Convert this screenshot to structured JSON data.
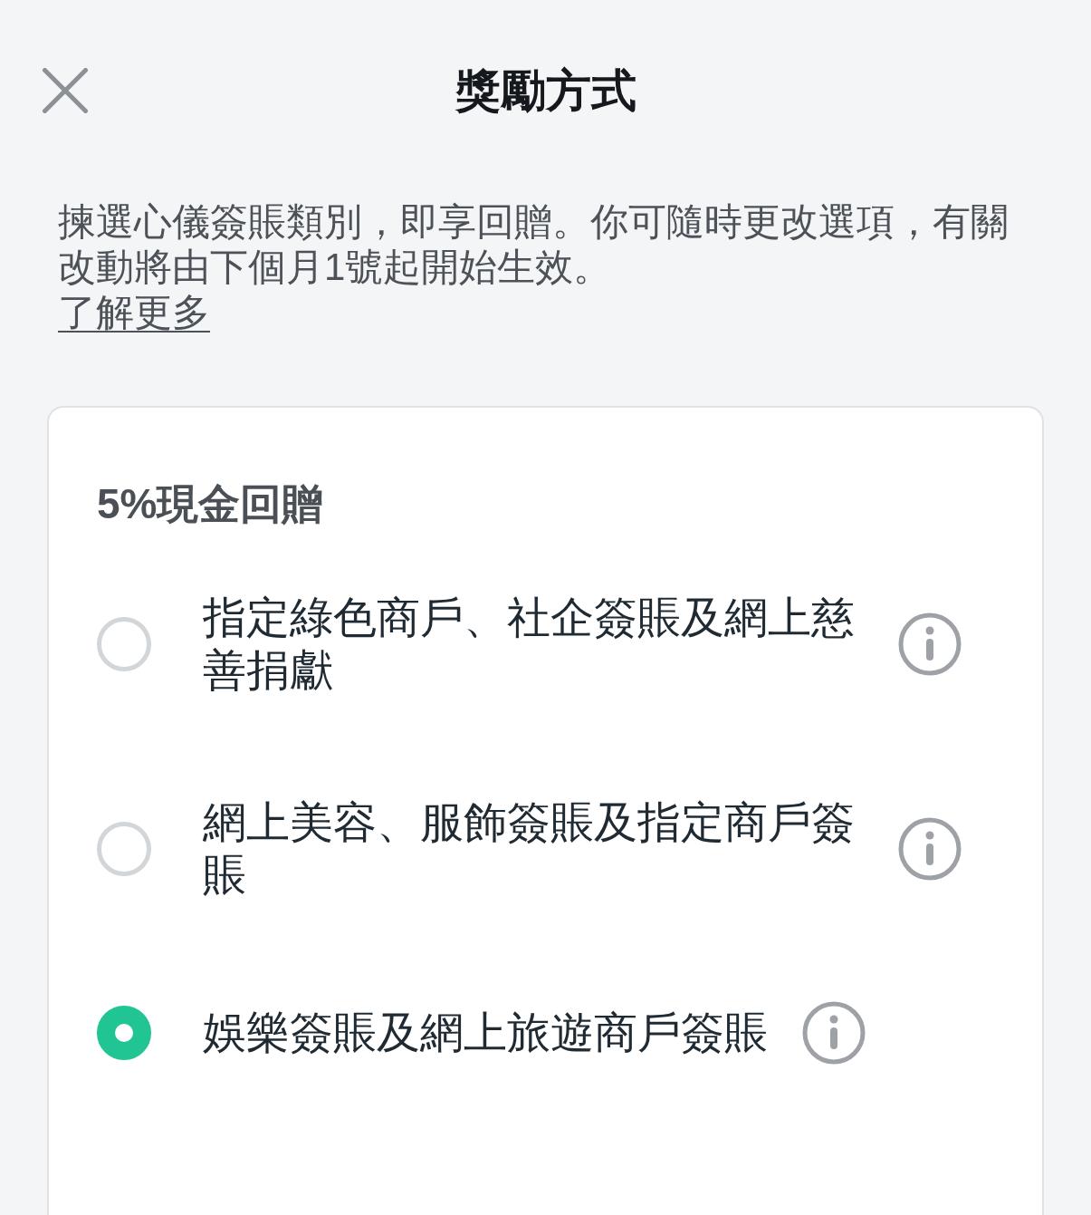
{
  "header": {
    "title": "獎勵方式"
  },
  "intro": {
    "text": "揀選心儀簽賬類別，即享回贈。你可隨時更改選項，有關改動將由下個月1號起開始生效。",
    "link": "了解更多"
  },
  "card": {
    "heading": "5%現金回贈",
    "options": [
      {
        "label": "指定綠色商戶、社企簽賬及網上慈善捐獻",
        "selected": false
      },
      {
        "label": "網上美容、服飾簽賬及指定商戶簽賬",
        "selected": false
      },
      {
        "label": "娛樂簽賬及網上旅遊商戶簽賬",
        "selected": true
      }
    ]
  }
}
